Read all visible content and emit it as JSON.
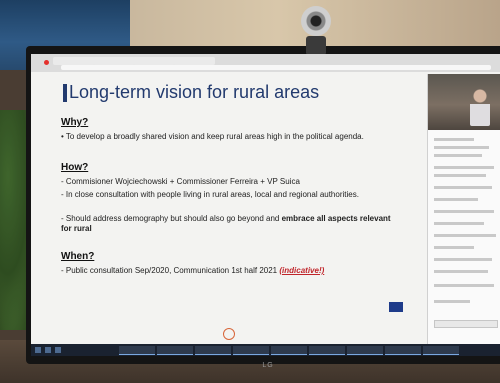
{
  "slide": {
    "title": "Long-term vision for rural areas",
    "caption": "",
    "sections": [
      {
        "heading": "Why?",
        "bullets": [
          "• To develop a broadly shared vision and keep rural areas high in the political agenda."
        ]
      },
      {
        "heading": "How?",
        "bullets": [
          "- Commisioner Wojciechowski + Commissioner Ferreira + VP Suica",
          "- In close consultation with people living in rural areas, local and regional authorities.",
          "- Should address demography but should also go beyond and",
          "embrace all aspects relevant for rural"
        ]
      },
      {
        "heading": "When?",
        "bullets": [
          "- Public consultation Sep/2020, Communication 1st half 2021",
          "(indicative!)"
        ]
      }
    ]
  },
  "monitor": {
    "brand": "LG"
  },
  "colors": {
    "title": "#223a6e",
    "red_note": "#c0242a",
    "taskbar": "#1a2230"
  }
}
